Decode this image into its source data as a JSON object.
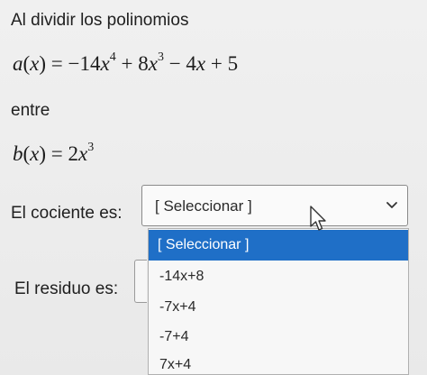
{
  "question": {
    "prompt": "Al dividir los polinomios",
    "separator": "entre",
    "poly_a": {
      "lhs_fn": "a",
      "lhs_var": "x",
      "term1_coef": "−14",
      "term1_var": "x",
      "term1_exp": "4",
      "term2_coef": "8",
      "term2_var": "x",
      "term2_exp": "3",
      "term3_coef": "4",
      "term3_var": "x",
      "constant": "5"
    },
    "poly_b": {
      "lhs_fn": "b",
      "lhs_var": "x",
      "coef": "2",
      "var": "x",
      "exp": "3"
    }
  },
  "cociente": {
    "label": "El cociente es:",
    "selected": "[ Seleccionar ]",
    "options": [
      "[ Seleccionar ]",
      "-14x+8",
      "-7x+4",
      "-7+4",
      "7x+4"
    ]
  },
  "residuo": {
    "label": "El residuo es:"
  },
  "icons": {
    "dropdown_arrow": "chevron-down-icon",
    "pointer": "mouse-pointer-icon"
  },
  "colors": {
    "highlight": "#1f6fc7",
    "highlight_text": "#ffffff"
  }
}
